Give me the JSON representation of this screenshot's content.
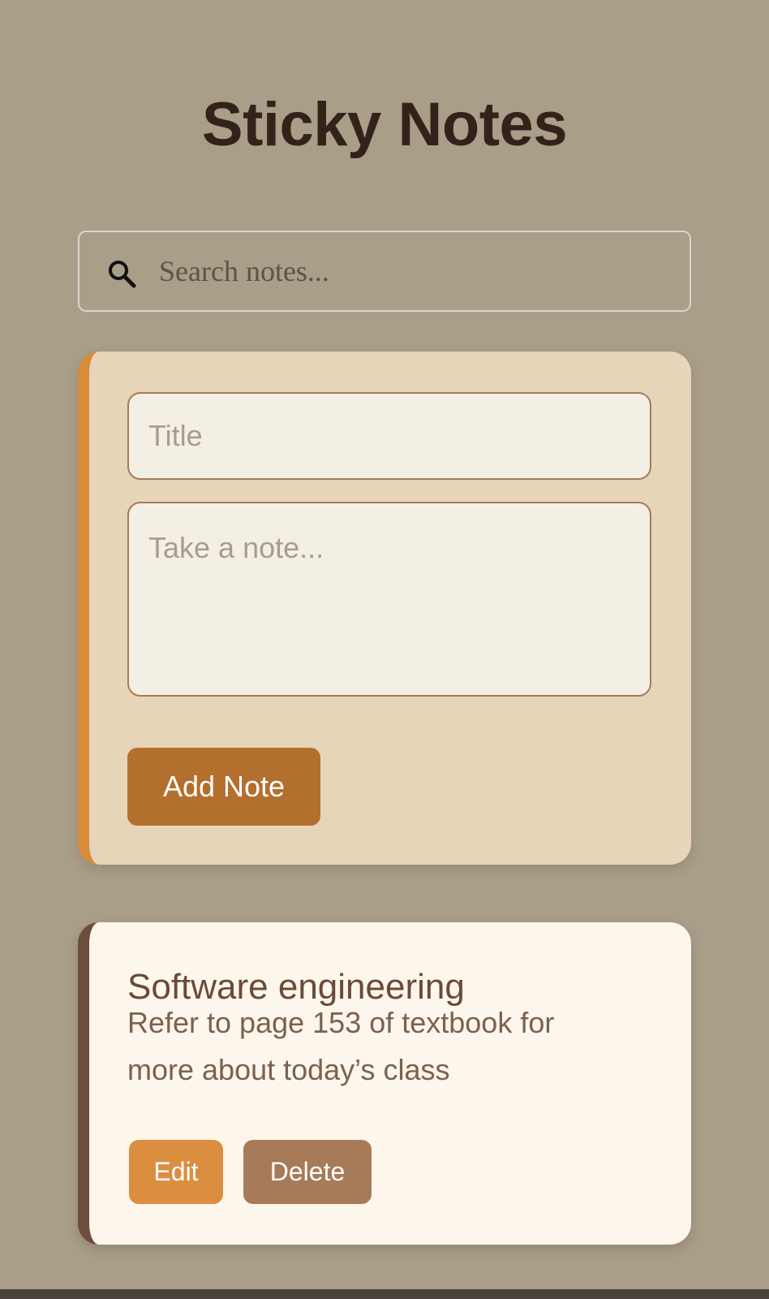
{
  "header": {
    "title": "Sticky Notes"
  },
  "search": {
    "placeholder": "Search notes...",
    "value": "",
    "icon": "search-icon"
  },
  "composer": {
    "title_placeholder": "Title",
    "body_placeholder": "Take a note...",
    "add_label": "Add Note"
  },
  "notes": [
    {
      "title": "Software engineering",
      "body": "Refer to page 153 of textbook for more about today’s class",
      "edit_label": "Edit",
      "delete_label": "Delete"
    }
  ],
  "colors": {
    "background": "#a99e88",
    "composer_bg": "#e7d5ba",
    "composer_accent": "#d98b3c",
    "add_button": "#b36f2e",
    "note_bg": "#fdf6ec",
    "note_accent": "#6b4e3b",
    "edit_button": "#db8e40",
    "delete_button": "#a77b57"
  }
}
